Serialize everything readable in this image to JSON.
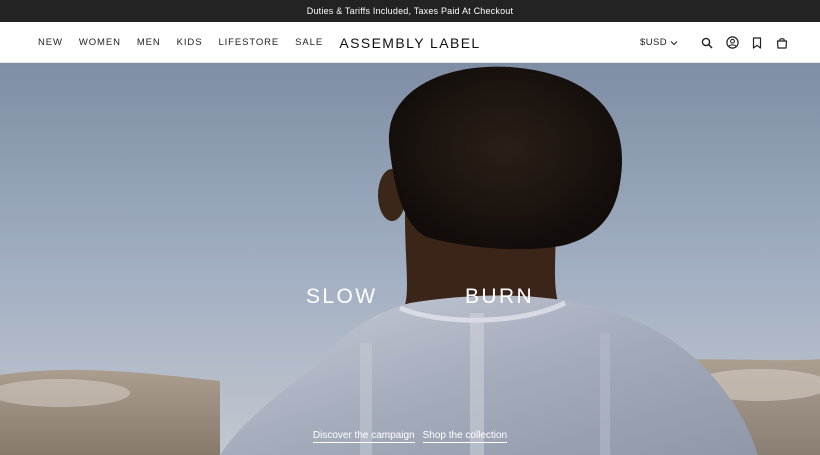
{
  "promo": {
    "text": "Duties & Tariffs Included, Taxes Paid At Checkout"
  },
  "nav": {
    "items": [
      {
        "label": "NEW"
      },
      {
        "label": "WOMEN"
      },
      {
        "label": "MEN"
      },
      {
        "label": "KIDS"
      },
      {
        "label": "LIFESTORE"
      },
      {
        "label": "SALE"
      }
    ]
  },
  "brand": {
    "logo": "ASSEMBLY LABEL"
  },
  "utility": {
    "currency": "$USD",
    "icons": [
      "chevron-down-icon",
      "search-icon",
      "account-icon",
      "bookmark-icon",
      "bag-icon"
    ]
  },
  "hero": {
    "headline_left": "SLOW",
    "headline_right": "BURN",
    "link_campaign": "Discover the campaign",
    "link_collection": "Shop the collection"
  },
  "colors": {
    "promo_bg": "#232323",
    "header_bg": "#ffffff",
    "text": "#222222",
    "hero_text": "#ffffff"
  }
}
